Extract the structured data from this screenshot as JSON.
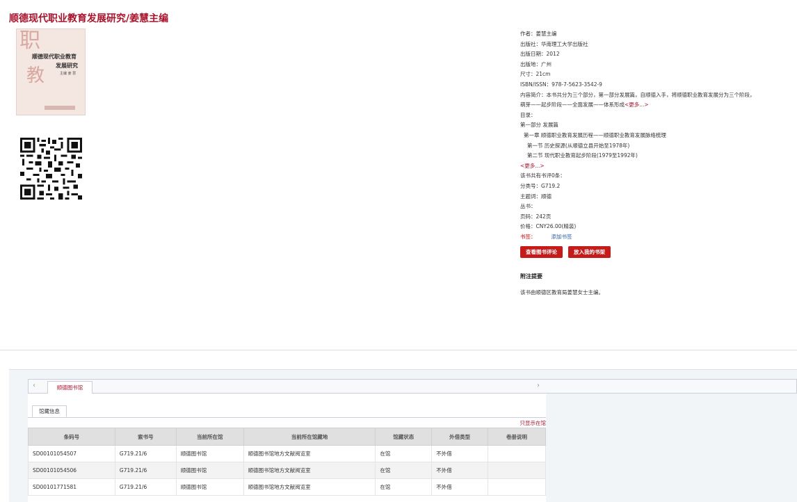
{
  "header": {
    "title": "顺德现代职业教育发展研究/姜慧主编"
  },
  "cover": {
    "big_char_1": "职",
    "big_char_2": "教",
    "title_line1": "顺德现代职业教育",
    "title_line2": "发展研究",
    "editor": "主编 姜 慧"
  },
  "info": {
    "author": "作者：姜慧主编",
    "publisher": "出版社：华南理工大学出版社",
    "pub_date": "出版日期：2012",
    "pub_place": "出版地：广州",
    "size": "尺寸：21cm",
    "isbn": "ISBN/ISSN：978-7-5623-3542-9",
    "summary_1": "内容简介：本书共分为三个部分，第一部分发展篇，自顺德入手，将顺德职业教育发展分为三个阶段，",
    "summary_2": "萌芽——起步阶段——全面发展——体系形成",
    "more_1": "<更多...>",
    "toc_label": "目录：",
    "toc_1": "第一部分  发展篇",
    "toc_2": "第一章  顺德职业教育发展历程——顺德职业教育发展脉络梳理",
    "toc_3": "第一节  历史探源(从顺德立县开始至1978年)",
    "toc_4": "第二节  现代职业教育起步阶段(1979至1992年)",
    "more_2": "<更多...>",
    "review_count": "该书共有书评0条：",
    "class_no": "分类号：G719.2",
    "subject": "主题词：顺德",
    "series": "丛书：",
    "pages": "页码：242页",
    "price": "价格：CNY26.00(精装)",
    "tags_label": "书签：",
    "add_tag": "添加书签"
  },
  "buttons": {
    "view_reviews": "查看图书评论",
    "add_shelf": "放入我的书架"
  },
  "note": {
    "heading": "附注提要",
    "text": "该书由顺德区教育局姜慧女士主编。"
  },
  "tabs": {
    "arrow_left": "‹",
    "arrow_right": "›",
    "library": "顺德图书馆",
    "holdings": "馆藏信息",
    "only_in_lib": "只显示在馆"
  },
  "table": {
    "headers": [
      "条码号",
      "索书号",
      "当前所在馆",
      "当前所在馆藏地",
      "馆藏状态",
      "外借类型",
      "卷册说明"
    ],
    "rows": [
      [
        "SD00101054507",
        "G719.21/6",
        "顺德图书馆",
        "顺德图书馆地方文献阅览室",
        "在馆",
        "不外借",
        ""
      ],
      [
        "SD00101054506",
        "G719.21/6",
        "顺德图书馆",
        "顺德图书馆地方文献阅览室",
        "在馆",
        "不外借",
        ""
      ],
      [
        "SD00101771581",
        "G719.21/6",
        "顺德图书馆",
        "顺德图书馆地方文献阅览室",
        "在馆",
        "不外借",
        ""
      ]
    ]
  },
  "colors": {
    "brand": "#a8132b",
    "button": "#c41b1b"
  }
}
